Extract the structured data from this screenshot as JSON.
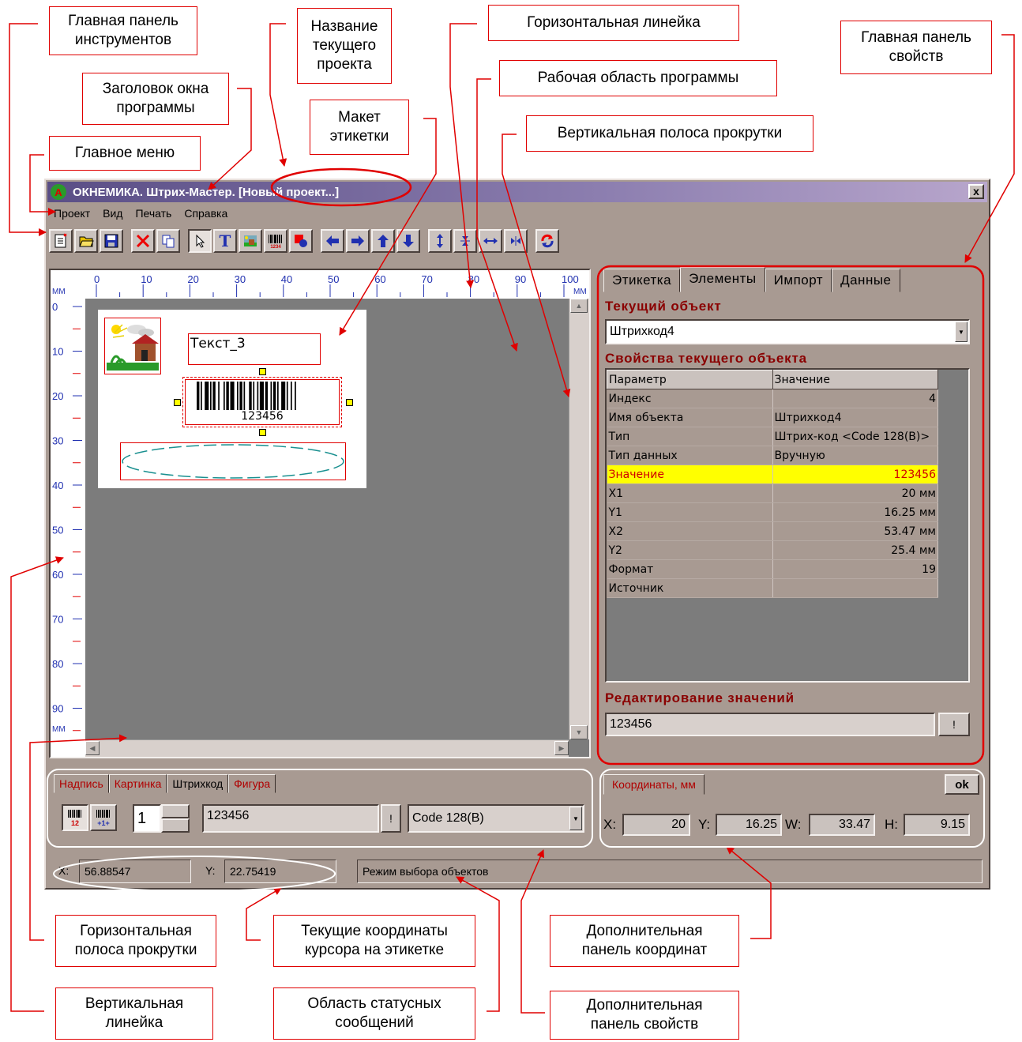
{
  "window": {
    "app_icon": "A",
    "title": "ОКНЕМИКА. Штрих-Мастер. [Новый проект...]",
    "close": "x"
  },
  "menu": [
    "Проект",
    "Вид",
    "Печать",
    "Справка"
  ],
  "toolbar_icons": [
    "new-icon",
    "open-icon",
    "save-icon",
    "delete-icon",
    "copy-icon",
    "pointer-icon",
    "text-icon",
    "picture-icon",
    "barcode-icon",
    "shape-icon",
    "arrow-left-icon",
    "arrow-right-icon",
    "arrow-up-icon",
    "arrow-down-icon",
    "align-vertical-icon",
    "center-vertical-icon",
    "align-horizontal-icon",
    "center-horizontal-icon",
    "refresh-icon"
  ],
  "rulers": {
    "unit": "MM",
    "h_ticks": [
      "0",
      "10",
      "20",
      "30",
      "40",
      "50",
      "60",
      "70",
      "80",
      "90",
      "100"
    ],
    "v_ticks": [
      "0",
      "10",
      "20",
      "30",
      "40",
      "50",
      "60",
      "70",
      "80",
      "90"
    ]
  },
  "label": {
    "text_object": "Текст_3",
    "barcode_text": "123456"
  },
  "props": {
    "tabs": [
      "Этикетка",
      "Элементы",
      "Импорт",
      "Данные"
    ],
    "active_tab": "Элементы",
    "current_object_title": "Текущий объект",
    "current_object": "Штрихкод4",
    "properties_title": "Свойства текущего объекта",
    "grid_headers": [
      "Параметр",
      "Значение"
    ],
    "rows": [
      [
        "Индекс",
        "4"
      ],
      [
        "Имя объекта",
        "Штрихкод4"
      ],
      [
        "Тип",
        "Штрих-код <Code 128(B)>"
      ],
      [
        "Тип данных",
        "Вручную"
      ],
      [
        "Значение",
        "123456"
      ],
      [
        "X1",
        "20 мм"
      ],
      [
        "Y1",
        "16.25 мм"
      ],
      [
        "X2",
        "53.47 мм"
      ],
      [
        "Y2",
        "25.4 мм"
      ],
      [
        "Формат",
        "19"
      ],
      [
        "Источник",
        ""
      ]
    ],
    "edit_title": "Редактирование значений",
    "edit_value": "123456",
    "apply_btn": "!"
  },
  "bottom": {
    "tabs": [
      "Надпись",
      "Картинка",
      "Штрихкод",
      "Фигура"
    ],
    "active_tab": "Штрихкод",
    "spin_value": "1",
    "barcode_value": "123456",
    "apply_btn": "!",
    "barcode_type": "Code 128(B)"
  },
  "coords": {
    "tab": "Координаты, мм",
    "ok": "ok",
    "x_label": "X:",
    "x": "20",
    "y_label": "Y:",
    "y": "16.25",
    "w_label": "W:",
    "w": "33.47",
    "h_label": "H:",
    "h": "9.15"
  },
  "status": {
    "x_label": "X:",
    "x": "56.88547",
    "y_label": "Y:",
    "y": "22.75419",
    "message": "Режим выбора объектов"
  },
  "callouts": {
    "main_toolbar": [
      "Главная панель",
      "инструментов"
    ],
    "project_name": [
      "Название",
      "текущего",
      "проекта"
    ],
    "h_ruler": [
      "Горизонтальная линейка"
    ],
    "main_props": [
      "Главная панель",
      "свойств"
    ],
    "window_title": [
      "Заголовок окна",
      "программы"
    ],
    "workspace": [
      "Рабочая область программы"
    ],
    "label_layout": [
      "Макет",
      "этикетки"
    ],
    "v_scroll": [
      "Вертикальная полоса прокрутки"
    ],
    "main_menu": [
      "Главное меню"
    ],
    "h_scroll": [
      "Горизонтальная",
      "полоса прокрутки"
    ],
    "cursor_coords": [
      "Текущие координаты",
      "курсора на этикетке"
    ],
    "extra_coords": [
      "Дополнительная",
      "панель координат"
    ],
    "v_ruler": [
      "Вертикальная",
      "линейка"
    ],
    "status_area": [
      "Область статусных",
      "сообщений"
    ],
    "extra_props": [
      "Дополнительная",
      "панель свойств"
    ]
  },
  "colors": {
    "accent": "#e00000",
    "window_bg": "#a89a92",
    "title_start": "#5a4e86",
    "highlight": "#ffff00"
  }
}
